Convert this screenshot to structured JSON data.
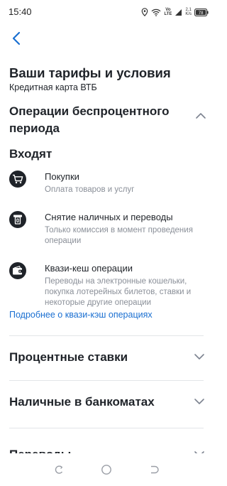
{
  "status_bar": {
    "time": "15:40",
    "network_label": "Vo\nLTE",
    "speed_label": "2,1\nK/s",
    "battery": "78"
  },
  "header": {
    "title": "Ваши тарифы и условия",
    "subtitle": "Кредитная карта ВТБ"
  },
  "grace_section": {
    "title": "Операции беспроцентного периода",
    "subheader": "Входят",
    "items": [
      {
        "icon": "cart-icon",
        "title": "Покупки",
        "description": "Оплата товаров и услуг"
      },
      {
        "icon": "atm-withdraw-icon",
        "title": "Снятие наличных и переводы",
        "description": "Только комиссия в момент проведения операции"
      },
      {
        "icon": "wallet-icon",
        "title": "Квази-кеш операции",
        "description": "Переводы на электронные кошельки, покупка лотерейных билетов, ставки и некоторые другие операции"
      }
    ],
    "link": "Подробнее о квази-кэш операциях"
  },
  "collapsed_sections": [
    {
      "title": "Процентные ставки"
    },
    {
      "title": "Наличные в банкоматах"
    },
    {
      "title": "Переводы"
    }
  ],
  "colors": {
    "text": "#1f2329",
    "secondary_text": "#8a8f98",
    "accent": "#1a6fd1",
    "divider": "#e3e5e8",
    "chevron": "#7c8390"
  }
}
